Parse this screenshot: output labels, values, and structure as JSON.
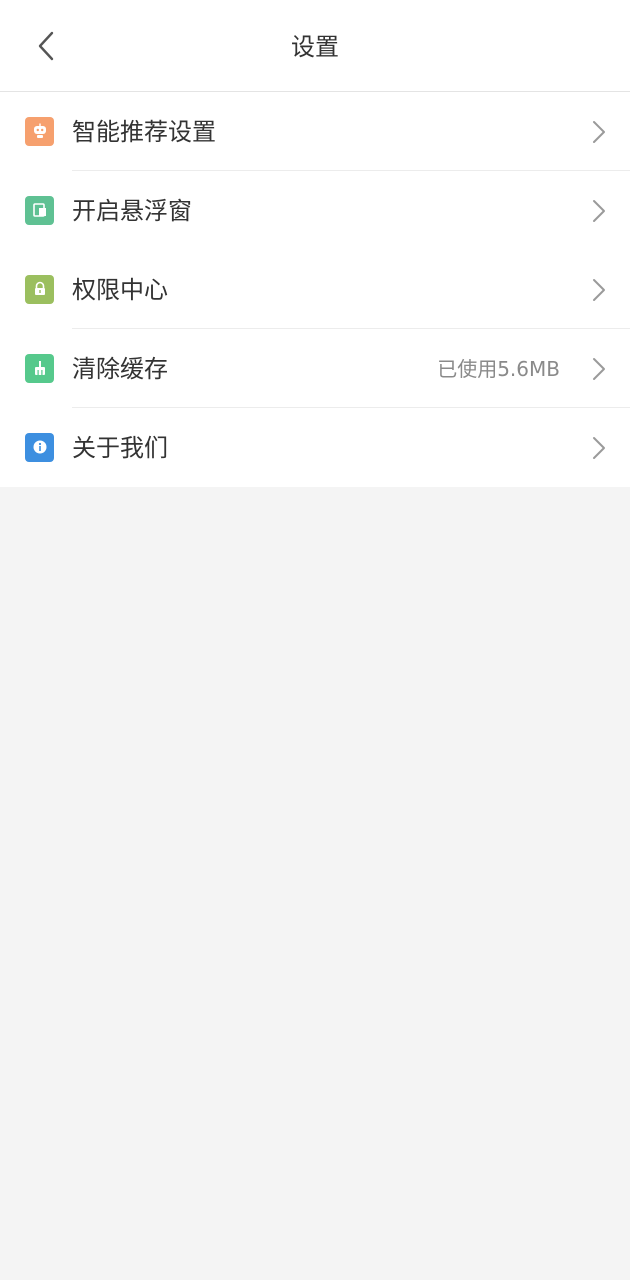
{
  "header": {
    "title": "设置",
    "back_icon": "chevron-left-icon"
  },
  "settings": {
    "items": [
      {
        "label": "智能推荐设置",
        "icon": "robot-icon",
        "icon_color": "#f6a06e",
        "value": ""
      },
      {
        "label": "开启悬浮窗",
        "icon": "floating-window-icon",
        "icon_color": "#5fc193",
        "value": ""
      },
      {
        "label": "权限中心",
        "icon": "lock-icon",
        "icon_color": "#9bbf5f",
        "value": ""
      },
      {
        "label": "清除缓存",
        "icon": "broom-icon",
        "icon_color": "#56c98c",
        "value": "已使用5.6MB"
      },
      {
        "label": "关于我们",
        "icon": "info-icon",
        "icon_color": "#3d8fe0",
        "value": ""
      }
    ]
  },
  "colors": {
    "background": "#f4f4f4",
    "surface": "#ffffff",
    "text": "#333333",
    "secondary_text": "#8a8a8a",
    "chevron": "#9a9a9a"
  }
}
